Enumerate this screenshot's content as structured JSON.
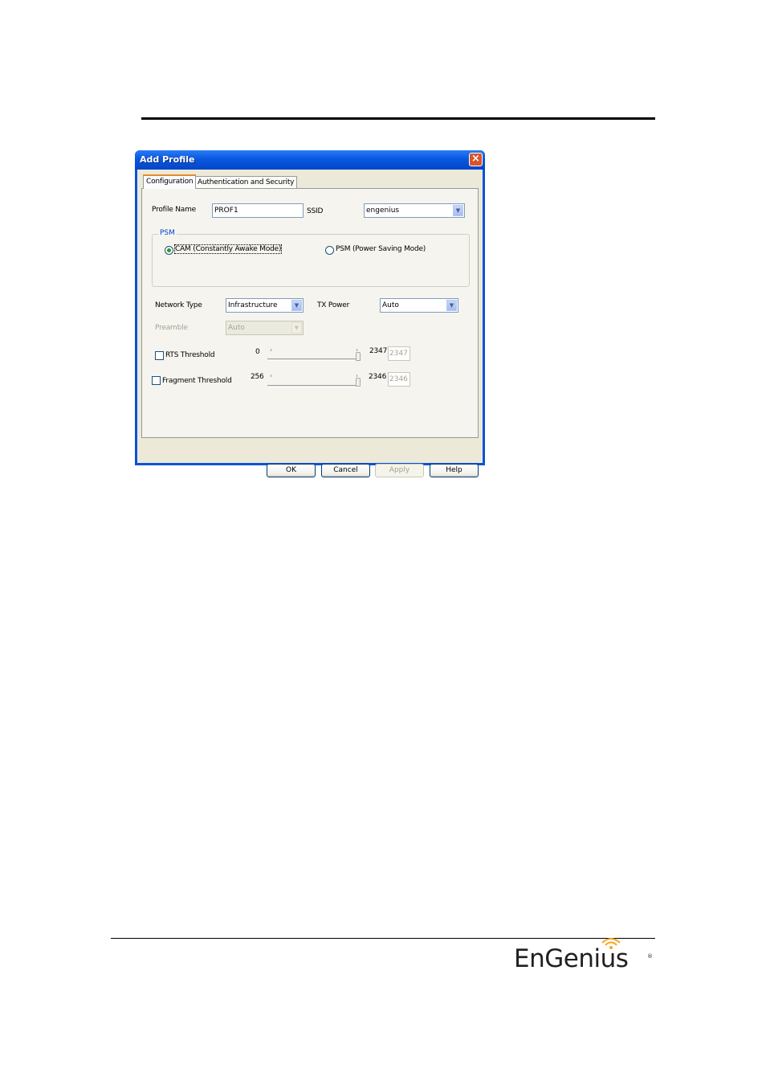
{
  "dialog": {
    "title": "Add Profile",
    "close_glyph": "×"
  },
  "tabs": [
    {
      "label": "Configuration",
      "active": true
    },
    {
      "label": "Authentication and Security",
      "active": false
    }
  ],
  "form": {
    "profile_name_label": "Profile Name",
    "profile_name_value": "PROF1",
    "ssid_label": "SSID",
    "ssid_value": "engenius",
    "psm_group_label": "PSM",
    "psm_options": [
      {
        "label": "CAM (Constantly Awake Mode)",
        "checked": true
      },
      {
        "label": "PSM (Power Saving Mode)",
        "checked": false
      }
    ],
    "network_type_label": "Network Type",
    "network_type_value": "Infrastructure",
    "tx_power_label": "TX Power",
    "tx_power_value": "Auto",
    "preamble_label": "Preamble",
    "preamble_value": "Auto",
    "rts": {
      "label": "RTS Threshold",
      "checked": false,
      "min": "0",
      "max": "2347",
      "value": "2347"
    },
    "fragment": {
      "label": "Fragment Threshold",
      "checked": false,
      "min": "256",
      "max": "2346",
      "value": "2346"
    }
  },
  "buttons": {
    "ok": "OK",
    "cancel": "Cancel",
    "apply": "Apply",
    "help": "Help"
  },
  "footer": {
    "logo_text": "EnGenius",
    "brand_color": "#f5a623"
  }
}
